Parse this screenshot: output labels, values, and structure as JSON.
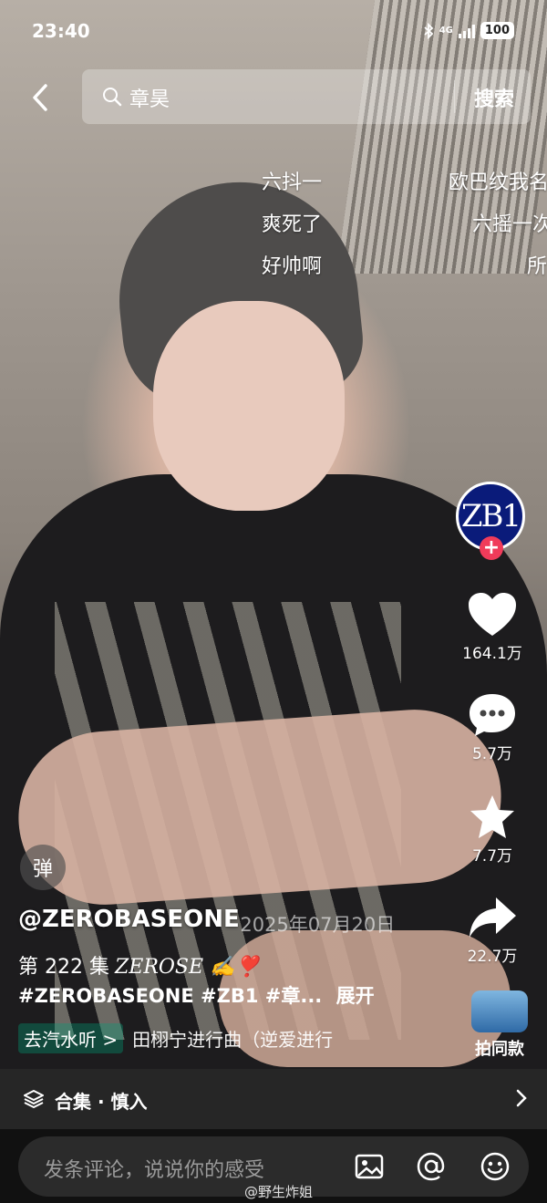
{
  "status_bar": {
    "time": "23:40",
    "network": "4G",
    "battery": "100"
  },
  "search": {
    "query": "章昊",
    "button_label": "搜索"
  },
  "danmaku": [
    {
      "text": "六抖一"
    },
    {
      "text": "欧巴纹我名"
    },
    {
      "text": "爽死了"
    },
    {
      "text": "六摇一次"
    },
    {
      "text": "好帅啊"
    },
    {
      "text": "所"
    }
  ],
  "actions": {
    "avatar_text": "ZB1",
    "likes": "164.1万",
    "comments": "5.7万",
    "favorites": "7.7万",
    "shares": "22.7万"
  },
  "danmaku_toggle": "弹",
  "video": {
    "author": "@ZEROBASEONE",
    "date": "· 2025年07月20日",
    "episode": "第 222 集",
    "episode_deco": "ZEROSE ✍️❣️",
    "hashtags": "#ZEROBASEONE #ZB1 #章...",
    "expand": "展开",
    "music_prefix": "去汽水听 >",
    "music_title": "田栩宁进行曲（逆爱进行"
  },
  "same_style": {
    "label": "拍同款"
  },
  "collection": {
    "label": "合集 · 慎入"
  },
  "comment_bar": {
    "placeholder": "发条评论，说说你的感受"
  },
  "watermark": "@野生炸姐",
  "colors": {
    "like": "#ffffff",
    "plus_badge": "#f03b5a",
    "avatar_bg": "#0a1b7a"
  }
}
